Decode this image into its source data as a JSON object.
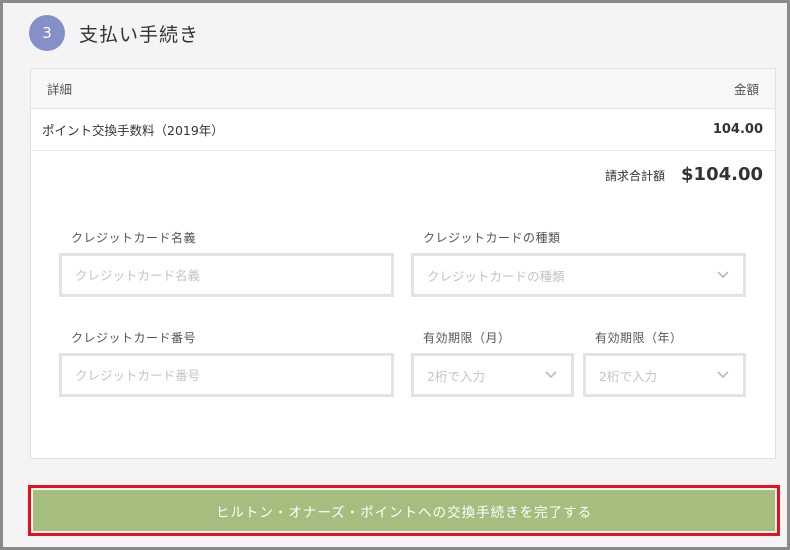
{
  "step": {
    "number": "3",
    "title": "支払い手続き"
  },
  "table": {
    "header_detail": "詳細",
    "header_amount": "金額",
    "rows": [
      {
        "description": "ポイント交換手数料（2019年）",
        "amount": "104.00"
      }
    ],
    "total_label": "請求合計額",
    "total_value": "$104.00"
  },
  "form": {
    "card_name": {
      "label": "クレジットカード名義",
      "placeholder": "クレジットカード名義"
    },
    "card_type": {
      "label": "クレジットカードの種類",
      "placeholder": "クレジットカードの種類"
    },
    "card_number": {
      "label": "クレジットカード番号",
      "placeholder": "クレジットカード番号"
    },
    "expiry_month": {
      "label": "有効期限（月）",
      "placeholder": "2桁で入力"
    },
    "expiry_year": {
      "label": "有効期限（年）",
      "placeholder": "2桁で入力"
    }
  },
  "submit": {
    "label": "ヒルトン・オナーズ・ポイントへの交換手続きを完了する"
  },
  "colors": {
    "step_circle": "#8590c8",
    "submit_bg": "#a6bd80",
    "highlight_border": "#e5121d"
  },
  "icons": {
    "select_caret": "chevron-down-icon"
  }
}
